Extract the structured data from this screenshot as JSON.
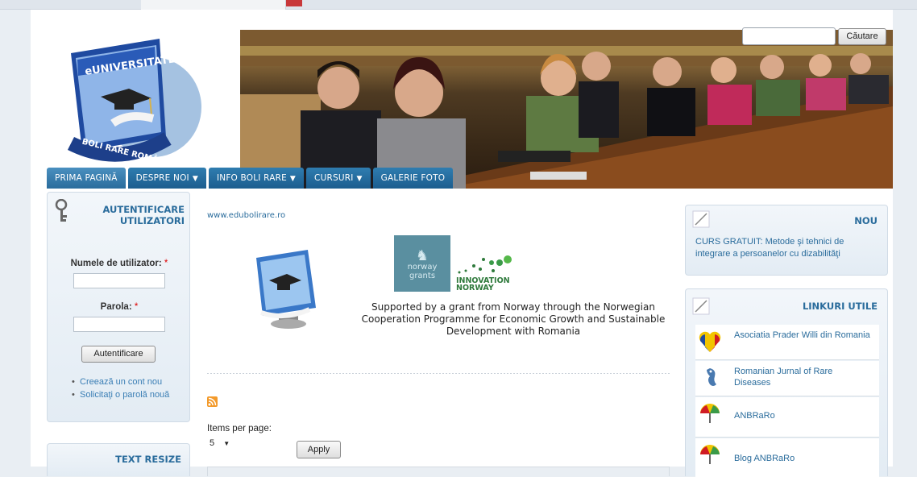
{
  "header": {
    "logo_text_top": "eUNIVERSITATE",
    "logo_text_bottom": "BOLI RARE ROMÂNIA",
    "search_placeholder": "",
    "search_button": "Căutare"
  },
  "nav": {
    "items": [
      {
        "label": "PRIMA PAGINĂ",
        "caret": ""
      },
      {
        "label": "DESPRE NOI",
        "caret": "▼"
      },
      {
        "label": "INFO BOLI RARE",
        "caret": "▼"
      },
      {
        "label": "CURSURI",
        "caret": "▼"
      },
      {
        "label": "GALERIE FOTO",
        "caret": ""
      }
    ]
  },
  "login": {
    "title": "AUTENTIFICARE UTILIZATORI",
    "username_label": "Numele de utilizator:",
    "password_label": "Parola:",
    "required_mark": "*",
    "submit": "Autentificare",
    "links": [
      "Creează un cont nou",
      "Solicitaţi o parolă nouă"
    ]
  },
  "text_resize": {
    "title": "TEXT RESIZE"
  },
  "main": {
    "site_link": "www.edubolirare.ro",
    "norway_grants": [
      "norway",
      "grants"
    ],
    "innovation_norway": [
      "INNOVATION",
      "NORWAY"
    ],
    "sponsor_text": "Supported by a grant from Norway through the Norwegian Cooperation Programme for Economic Growth and Sustainable Development with Romania",
    "items_per_page_label": "Items per page:",
    "items_per_page_value": "5",
    "apply": "Apply"
  },
  "nou": {
    "title": "NOU",
    "text": "CURS GRATUIT: Metode şi tehnici de integrare a persoanelor cu dizabilităţi"
  },
  "linkuri": {
    "title": "LINKURI UTILE",
    "items": [
      {
        "label": "Asociatia Prader Willi din Romania",
        "icon": "heart-flag-icon"
      },
      {
        "label": "Romanian Jurnal of Rare Diseases",
        "icon": "seahorse-icon"
      },
      {
        "label": "ANBRaRo",
        "icon": "umbrella-icon"
      },
      {
        "label": "Blog ANBRaRo",
        "icon": "umbrella-icon"
      }
    ]
  }
}
